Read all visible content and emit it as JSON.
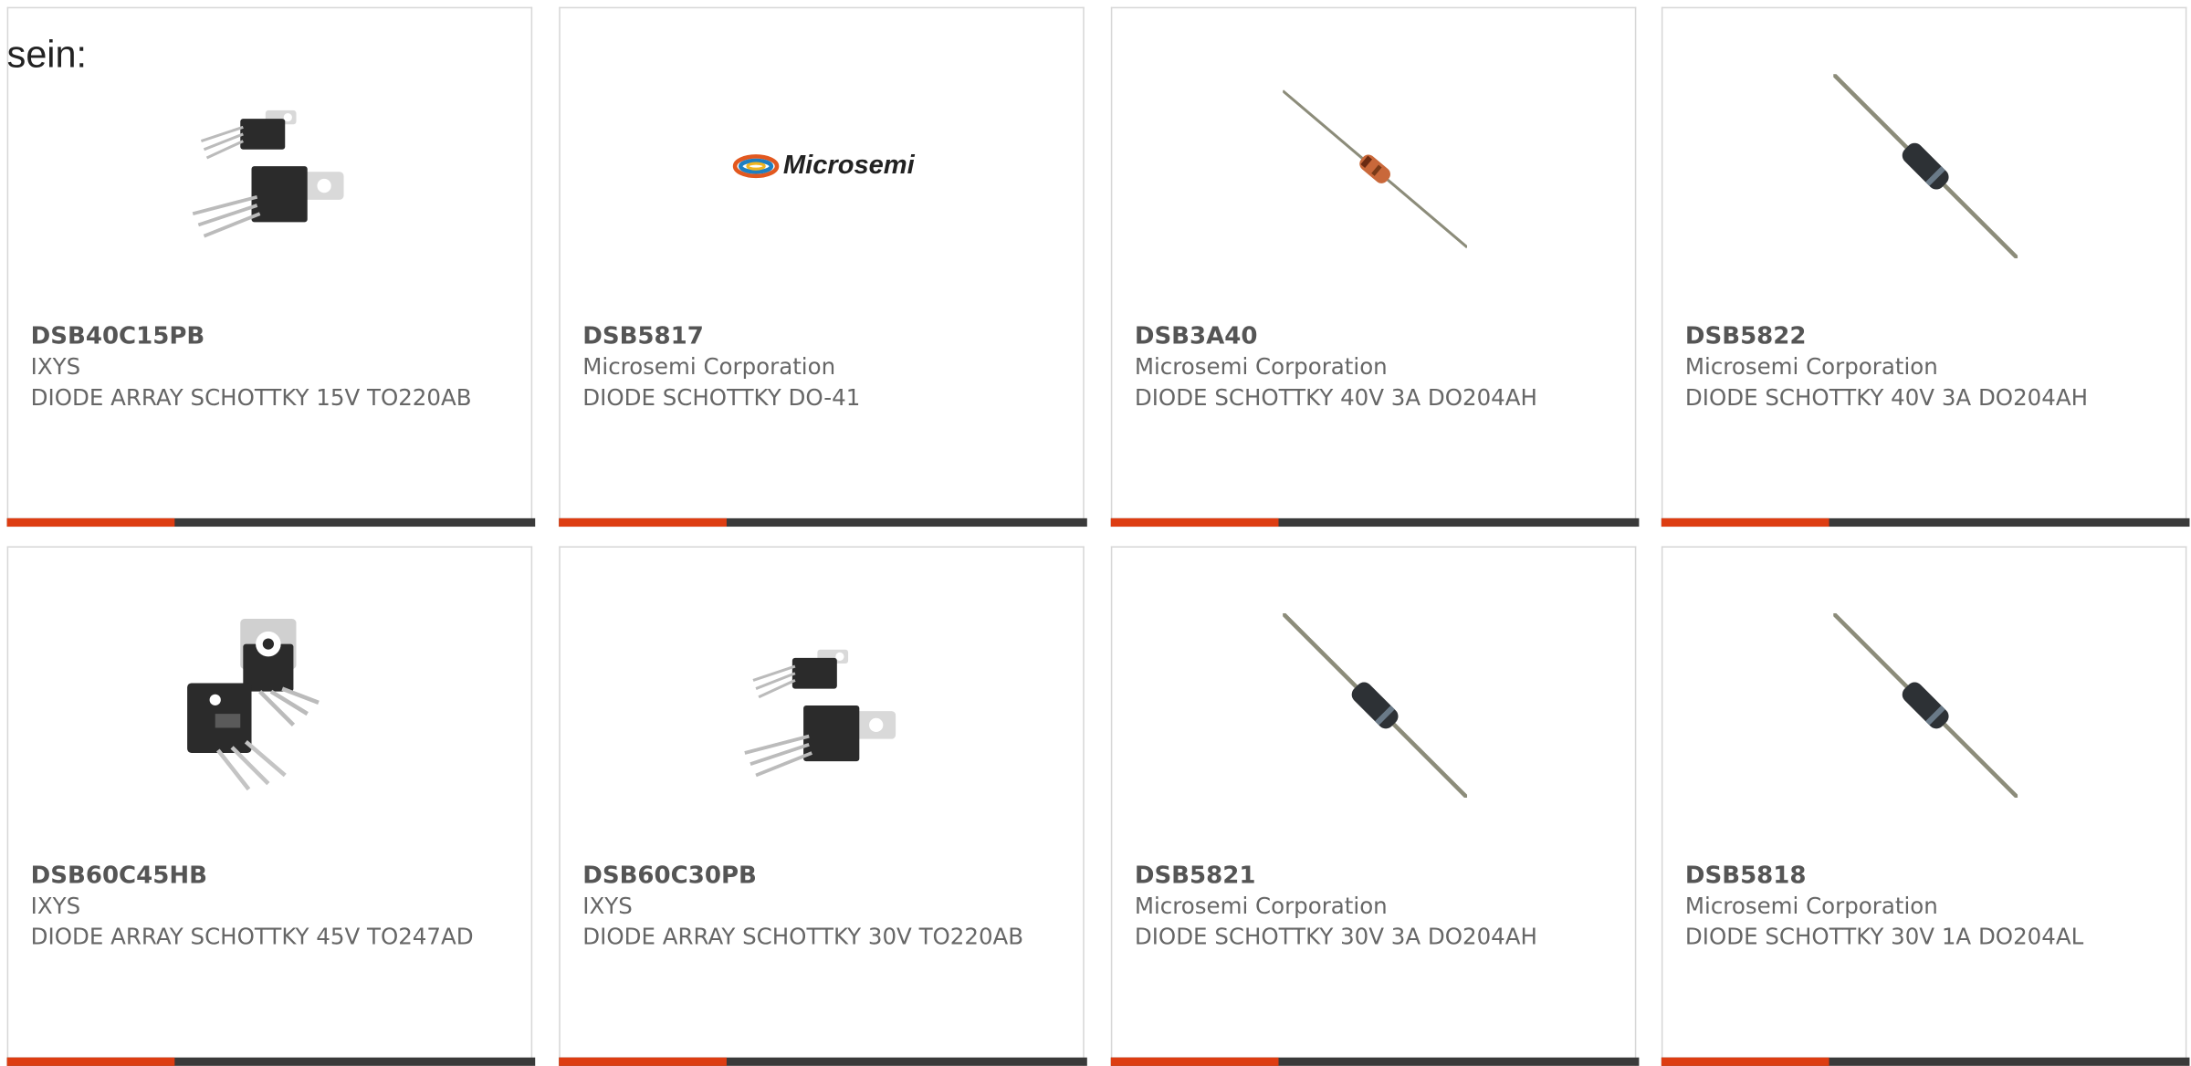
{
  "intro_text": "sein:",
  "colors": {
    "accent": "#dd3d12",
    "bar": "#3a3a3a",
    "border": "#d7d7d7"
  },
  "cards": [
    {
      "part": "DSB40C15PB",
      "manufacturer": "IXYS",
      "description": "DIODE ARRAY SCHOTTKY 15V TO220AB",
      "image": "to220-package-icon"
    },
    {
      "part": "DSB5817",
      "manufacturer": "Microsemi Corporation",
      "description": "DIODE SCHOTTKY DO-41",
      "image": "microsemi-logo",
      "logo_text": "Microsemi"
    },
    {
      "part": "DSB3A40",
      "manufacturer": "Microsemi Corporation",
      "description": "DIODE SCHOTTKY 40V 3A DO204AH",
      "image": "glass-axial-diode-icon"
    },
    {
      "part": "DSB5822",
      "manufacturer": "Microsemi Corporation",
      "description": "DIODE SCHOTTKY 40V 3A DO204AH",
      "image": "axial-diode-icon"
    },
    {
      "part": "DSB60C45HB",
      "manufacturer": "IXYS",
      "description": "DIODE ARRAY SCHOTTKY 45V TO247AD",
      "image": "to247-package-icon"
    },
    {
      "part": "DSB60C30PB",
      "manufacturer": "IXYS",
      "description": "DIODE ARRAY SCHOTTKY 30V TO220AB",
      "image": "to220-package-icon"
    },
    {
      "part": "DSB5821",
      "manufacturer": "Microsemi Corporation",
      "description": "DIODE SCHOTTKY 30V 3A DO204AH",
      "image": "axial-diode-icon"
    },
    {
      "part": "DSB5818",
      "manufacturer": "Microsemi Corporation",
      "description": "DIODE SCHOTTKY 30V 1A DO204AL",
      "image": "axial-diode-icon"
    }
  ]
}
